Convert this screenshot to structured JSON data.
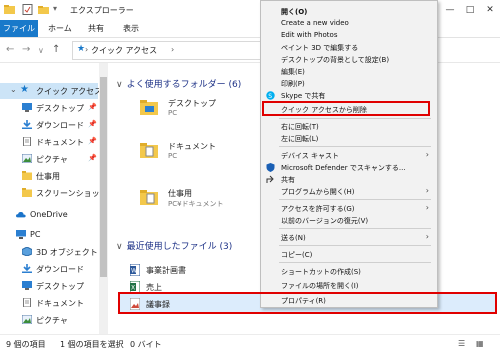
{
  "window": {
    "title": "エクスプローラー",
    "controls": [
      "—",
      "□",
      "✕"
    ]
  },
  "ribbon": {
    "tabs": [
      "ファイル",
      "ホーム",
      "共有",
      "表示"
    ]
  },
  "address": {
    "path_root": "クイック アクセス",
    "chevron": "›"
  },
  "sidebar": {
    "items": [
      {
        "label": "クイック アクセス",
        "icon": "star-icon",
        "pinned": false,
        "selected": true
      },
      {
        "label": "デスクトップ",
        "icon": "desktop-icon",
        "pinned": true
      },
      {
        "label": "ダウンロード",
        "icon": "download-icon",
        "pinned": true
      },
      {
        "label": "ドキュメント",
        "icon": "document-icon",
        "pinned": true
      },
      {
        "label": "ピクチャ",
        "icon": "picture-icon",
        "pinned": true
      },
      {
        "label": "仕事用",
        "icon": "folder-icon",
        "pinned": false
      },
      {
        "label": "スクリーンショット",
        "icon": "folder-icon",
        "pinned": false
      },
      {
        "label": "OneDrive",
        "icon": "cloud-icon",
        "pinned": false
      },
      {
        "label": "PC",
        "icon": "pc-icon",
        "pinned": false
      },
      {
        "label": "3D オブジェクト",
        "icon": "cube-icon",
        "pinned": false
      },
      {
        "label": "ダウンロード",
        "icon": "download-icon",
        "pinned": false
      },
      {
        "label": "デスクトップ",
        "icon": "desktop-icon",
        "pinned": false
      },
      {
        "label": "ドキュメント",
        "icon": "document-icon",
        "pinned": false
      },
      {
        "label": "ピクチャ",
        "icon": "picture-icon",
        "pinned": false
      }
    ]
  },
  "content": {
    "frequent_header": "よく使用するフォルダー (6)",
    "frequent": [
      {
        "name": "デスクトップ",
        "location": "PC"
      },
      {
        "name": "ドキュメント",
        "location": "PC"
      },
      {
        "name": "仕事用",
        "location": "PC¥ドキュメント"
      }
    ],
    "recent_header": "最近使用したファイル (3)",
    "recent": [
      {
        "name": "事業計画書"
      },
      {
        "name": "売上"
      },
      {
        "name": "議事録"
      }
    ]
  },
  "status": {
    "count": "9 個の項目",
    "selection": "1 個の項目を選択",
    "size": "0 バイト"
  },
  "context_menu": {
    "items": [
      {
        "label": "開く(O)"
      },
      {
        "label": "Create a new video"
      },
      {
        "label": "Edit with Photos"
      },
      {
        "label": "ペイント 3D で編集する"
      },
      {
        "label": "デスクトップの背景として設定(B)"
      },
      {
        "label": "編集(E)"
      },
      {
        "label": "印刷(P)"
      },
      {
        "label": "Skype で共有"
      },
      {
        "label": "クイック アクセスから削除"
      },
      {
        "label": "右に回転(T)"
      },
      {
        "label": "左に回転(L)"
      },
      {
        "label": "デバイス キャスト"
      },
      {
        "label": "Microsoft Defender でスキャンする..."
      },
      {
        "label": "共有"
      },
      {
        "label": "プログラムから開く(H)"
      },
      {
        "label": "アクセスを許可する(G)"
      },
      {
        "label": "以前のバージョンの復元(V)"
      },
      {
        "label": "送る(N)"
      },
      {
        "label": "コピー(C)"
      },
      {
        "label": "ショートカットの作成(S)"
      },
      {
        "label": "ファイルの場所を開く(I)"
      },
      {
        "label": "プロパティ(R)"
      }
    ]
  },
  "colors": {
    "accent": "#1979ca",
    "highlight_border": "#e00000",
    "folder_yellow": "#f3c84b"
  }
}
